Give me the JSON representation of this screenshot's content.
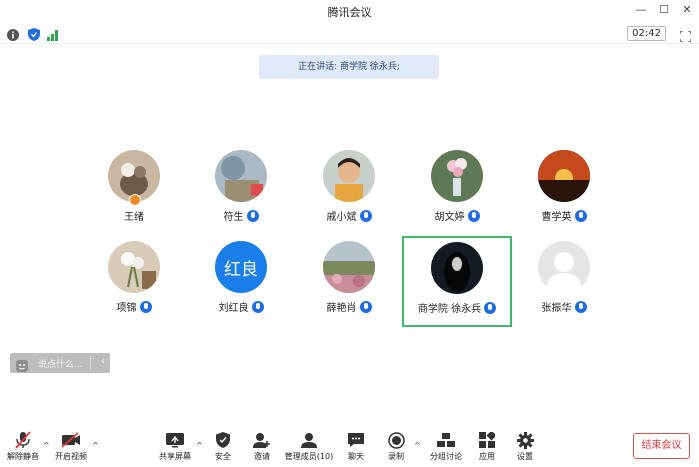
{
  "window": {
    "title": "腾讯会议"
  },
  "status": {
    "timer": "02:42"
  },
  "speaking": {
    "text": "正在讲话: 商学院 徐永兵;"
  },
  "participants": [
    {
      "name": "王绪"
    },
    {
      "name": "符生"
    },
    {
      "name": "戚小斌"
    },
    {
      "name": "胡文婷"
    },
    {
      "name": "曹学英"
    },
    {
      "name": "项锦"
    },
    {
      "name": "刘红良",
      "avatar_text": "红良"
    },
    {
      "name": "薛艳肖"
    },
    {
      "name": "商学院 徐永兵"
    },
    {
      "name": "张振华"
    }
  ],
  "chat": {
    "placeholder": "说点什么..."
  },
  "toolbar": {
    "mute": "解除静音",
    "video": "开启视频",
    "share": "共享屏幕",
    "security": "安全",
    "invite": "邀请",
    "members": "管理成员(10)",
    "chat": "聊天",
    "record": "录制",
    "breakout": "分组讨论",
    "apps": "应用",
    "settings": "设置"
  },
  "end_button": "结束会议",
  "colors": {
    "accent": "#1e6de0",
    "active_border": "#3dbb6b",
    "end": "#e03b3b"
  }
}
